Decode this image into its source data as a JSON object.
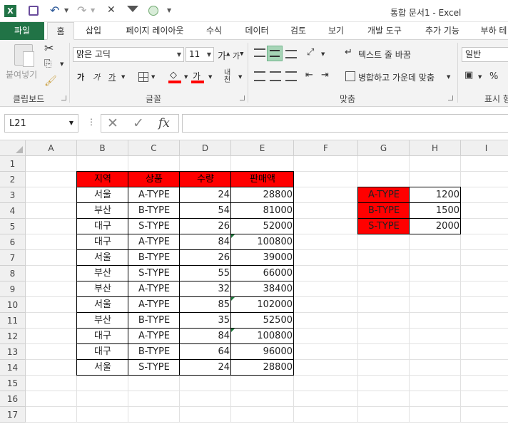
{
  "window": {
    "title": "통합 문서1 - Excel",
    "accent": "#217346"
  },
  "tabs": [
    "파일",
    "홈",
    "삽입",
    "페이지 레이아웃",
    "수식",
    "데이터",
    "검토",
    "보기",
    "개발 도구",
    "추가 기능",
    "부하 테"
  ],
  "ribbon": {
    "clipboard": {
      "paste": "붙여넣기",
      "label": "클립보드"
    },
    "font": {
      "name": "맑은 고딕",
      "size": "11",
      "label": "글꼴",
      "grow": "가",
      "shrink": "가",
      "bold": "가",
      "italic": "가",
      "underline": "가",
      "fontcolor": "가",
      "phonetic": "내천"
    },
    "align": {
      "wrap": "텍스트 줄 바꿈",
      "merge": "병합하고 가운데 맞춤",
      "label": "맞춤"
    },
    "number": {
      "format": "일반",
      "percent": "%",
      "label": "표시 형"
    }
  },
  "formula_bar": {
    "namebox": "L21",
    "fx": "fx",
    "value": ""
  },
  "sheet": {
    "columns": [
      "A",
      "B",
      "C",
      "D",
      "E",
      "F",
      "G",
      "H",
      "I"
    ],
    "rows": [
      "1",
      "2",
      "3",
      "4",
      "5",
      "6",
      "7",
      "8",
      "9",
      "10",
      "11",
      "12",
      "13",
      "14",
      "15",
      "16",
      "17"
    ],
    "header_fill": "#ff0000",
    "table_headers": [
      "지역",
      "상품",
      "수량",
      "판매액"
    ],
    "table_rows": [
      [
        "서울",
        "A-TYPE",
        "24",
        "28800"
      ],
      [
        "부산",
        "B-TYPE",
        "54",
        "81000"
      ],
      [
        "대구",
        "S-TYPE",
        "26",
        "52000"
      ],
      [
        "대구",
        "A-TYPE",
        "84",
        "100800"
      ],
      [
        "서울",
        "B-TYPE",
        "26",
        "39000"
      ],
      [
        "부산",
        "S-TYPE",
        "55",
        "66000"
      ],
      [
        "부산",
        "A-TYPE",
        "32",
        "38400"
      ],
      [
        "서울",
        "A-TYPE",
        "85",
        "102000"
      ],
      [
        "부산",
        "B-TYPE",
        "35",
        "52500"
      ],
      [
        "대구",
        "A-TYPE",
        "84",
        "100800"
      ],
      [
        "대구",
        "B-TYPE",
        "64",
        "96000"
      ],
      [
        "서울",
        "S-TYPE",
        "24",
        "28800"
      ]
    ],
    "price_table": [
      [
        "A-TYPE",
        "1200"
      ],
      [
        "B-TYPE",
        "1500"
      ],
      [
        "S-TYPE",
        "2000"
      ]
    ],
    "error_flag_rows": [
      5,
      9,
      11
    ]
  }
}
